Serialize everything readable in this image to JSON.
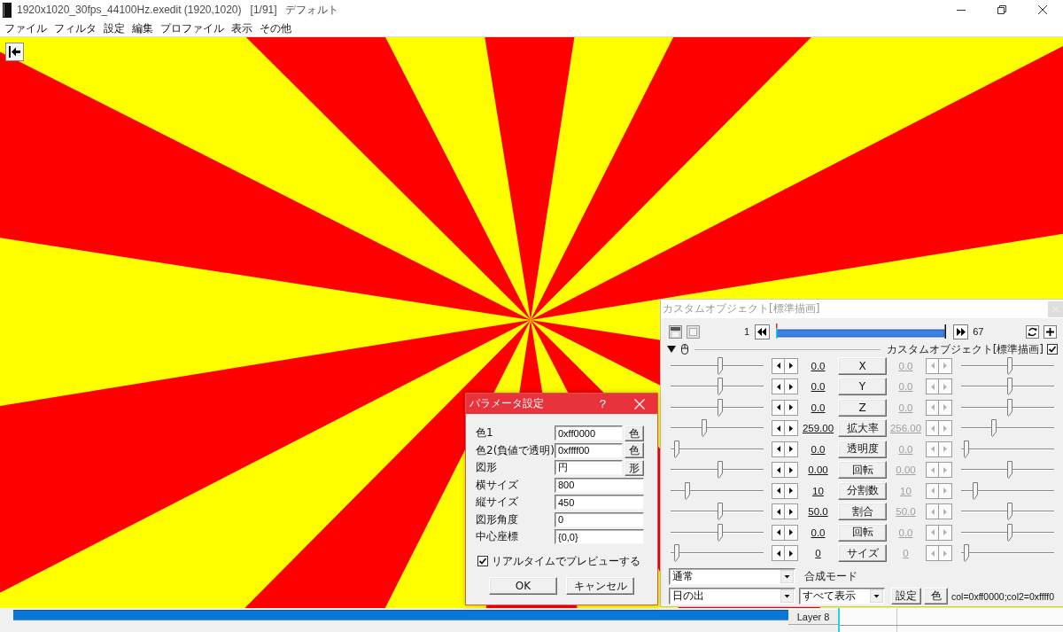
{
  "window": {
    "title": "1920x1020_30fps_44100Hz.exedit (1920,1020)",
    "frame": "[1/91]",
    "profile": "デフォルト"
  },
  "menu": [
    "ファイル",
    "フィルタ",
    "設定",
    "編集",
    "プロファイル",
    "表示",
    "その他"
  ],
  "object_panel": {
    "title": "カスタムオブジェクト[標準描画]",
    "start_frame": "1",
    "end_frame": "67",
    "filter": {
      "name": "カスタムオブジェクト[標準描画]",
      "expanded": true,
      "enabled": true
    },
    "tracks": [
      {
        "name": "X",
        "start": {
          "value": "0.0",
          "level": 0.54,
          "disabled": false
        },
        "end": {
          "value": "0.0",
          "level": 0.53,
          "disabled": true
        }
      },
      {
        "name": "Y",
        "start": {
          "value": "0.0",
          "level": 0.54,
          "disabled": false
        },
        "end": {
          "value": "0.0",
          "level": 0.53,
          "disabled": true
        }
      },
      {
        "name": "Z",
        "start": {
          "value": "0.0",
          "level": 0.54,
          "disabled": false
        },
        "end": {
          "value": "0.0",
          "level": 0.53,
          "disabled": true
        }
      },
      {
        "name": "拡大率",
        "start": {
          "value": "259.00",
          "level": 0.35,
          "disabled": false
        },
        "end": {
          "value": "256.00",
          "level": 0.34,
          "disabled": true
        }
      },
      {
        "name": "透明度",
        "start": {
          "value": "0.0",
          "level": 0.04,
          "disabled": false
        },
        "end": {
          "value": "0.0",
          "level": 0.03,
          "disabled": true
        }
      },
      {
        "name": "回転",
        "start": {
          "value": "0.00",
          "level": 0.54,
          "disabled": false
        },
        "end": {
          "value": "0.00",
          "level": 0.53,
          "disabled": true
        }
      },
      {
        "name": "分割数",
        "start": {
          "value": "10",
          "level": 0.16,
          "disabled": false
        },
        "end": {
          "value": "10",
          "level": 0.13,
          "disabled": true
        }
      },
      {
        "name": "割合",
        "start": {
          "value": "50.0",
          "level": 0.54,
          "disabled": false
        },
        "end": {
          "value": "50.0",
          "level": 0.53,
          "disabled": true
        }
      },
      {
        "name": "回転",
        "start": {
          "value": "0.0",
          "level": 0.54,
          "disabled": false
        },
        "end": {
          "value": "0.0",
          "level": 0.53,
          "disabled": true
        }
      },
      {
        "name": "サイズ",
        "start": {
          "value": "0",
          "level": 0.04,
          "disabled": false
        },
        "end": {
          "value": "0",
          "level": 0.03,
          "disabled": true
        }
      }
    ],
    "blend_mode": {
      "value": "通常",
      "label": "合成モード"
    },
    "script": "日の出",
    "display": "すべて表示",
    "buttons": [
      "設定",
      "色"
    ],
    "params": "col=0xff0000;col2=0xffff0"
  },
  "param_dialog": {
    "title": "パラメータ設定",
    "help": "?",
    "fields": [
      {
        "label": "色1",
        "value": "0xff0000",
        "button": "色"
      },
      {
        "label": "色2(負値で透明)",
        "value": "0xffff00",
        "button": "色"
      },
      {
        "label": "図形",
        "value": "円",
        "button": "形"
      },
      {
        "label": "横サイズ",
        "value": "800"
      },
      {
        "label": "縦サイズ",
        "value": "450"
      },
      {
        "label": "図形角度",
        "value": "0"
      },
      {
        "label": "中心座標",
        "value": "{0,0}"
      }
    ],
    "realtime_preview": {
      "label": "リアルタイムでプレビューする",
      "checked": true
    },
    "buttons": [
      "OK",
      "キャンセル"
    ]
  },
  "timeline": {
    "layer": "Layer 8"
  }
}
